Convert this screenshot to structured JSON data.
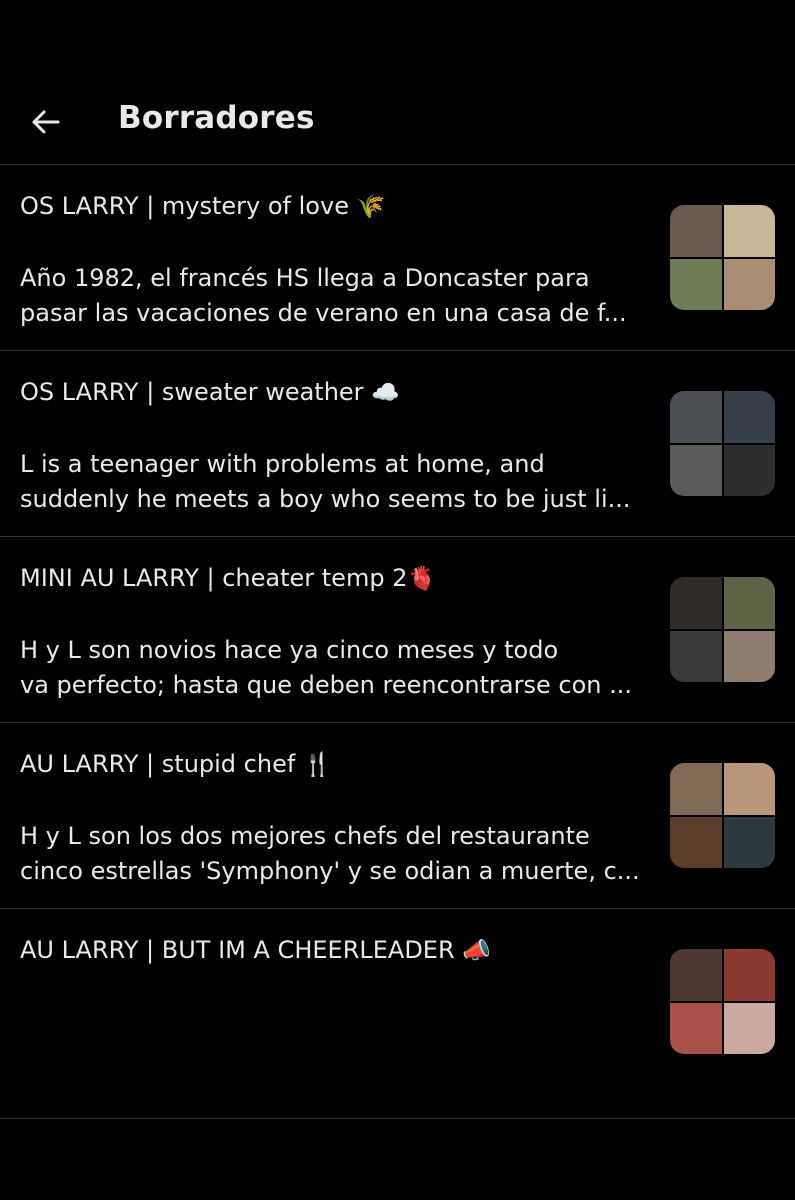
{
  "header": {
    "back_icon": "arrow-left-icon",
    "title": "Borradores"
  },
  "drafts": [
    {
      "title": "OS LARRY | mystery of love",
      "emoji": "🌾",
      "body": "Año 1982, el francés HS llega a Doncaster para\npasar las vacaciones de verano en una casa de f...",
      "thumb_colors": [
        "#6b5a4e",
        "#c8b89a",
        "#6d7d55",
        "#a88f72"
      ]
    },
    {
      "title": "OS LARRY | sweater weather",
      "emoji": "☁️",
      "body": "L is a teenager with problems at home, and\nsuddenly he meets a boy who seems to be just li...",
      "thumb_colors": [
        "#4b4e52",
        "#37404a",
        "#5a5a5a",
        "#2d2d2f"
      ]
    },
    {
      "title": "MINI AU LARRY | cheater temp 2",
      "emoji": "🫀",
      "body": "H y L son novios hace ya cinco meses y todo\nva perfecto; hasta que deben reencontrarse con ...",
      "thumb_colors": [
        "#2f2b28",
        "#5f6245",
        "#3a3a3c",
        "#8c7d70"
      ]
    },
    {
      "title": "AU LARRY | stupid chef",
      "emoji": "🍴",
      "body": "H y L son los dos mejores chefs del restaurante\ncinco estrellas 'Symphony' y se odian a muerte, c...",
      "thumb_colors": [
        "#7e6a55",
        "#b79777",
        "#5a3e2a",
        "#2f3940"
      ]
    },
    {
      "title": "AU LARRY | BUT IM A CHEERLEADER",
      "emoji": "📣",
      "body": "",
      "thumb_colors": [
        "#4d3a33",
        "#8a3a2e",
        "#a8524a",
        "#c9a9a0"
      ]
    }
  ]
}
